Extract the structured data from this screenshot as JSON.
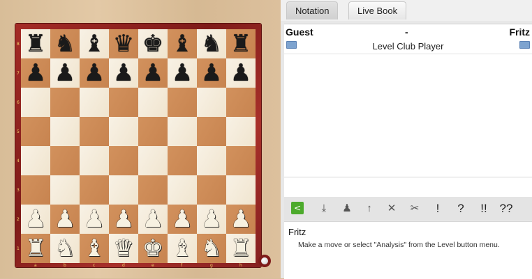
{
  "tabs": [
    {
      "label": "Notation",
      "active": true
    },
    {
      "label": "Live Book",
      "active": false
    }
  ],
  "game": {
    "white_player": "Guest",
    "result": "-",
    "black_player": "Fritz",
    "level": "Level Club Player"
  },
  "toolbar": {
    "icons": [
      "share-icon",
      "download-icon",
      "promote-variation-icon",
      "move-up-icon",
      "delete-move-icon",
      "cut-icon"
    ],
    "annotations": [
      "!",
      "?",
      "!!",
      "??"
    ]
  },
  "engine": {
    "name": "Fritz",
    "message": "Make a move or select \"Analysis\" from the Level button menu."
  },
  "board": {
    "orientation": "white-bottom",
    "files": [
      "a",
      "b",
      "c",
      "d",
      "e",
      "f",
      "g",
      "h"
    ],
    "ranks": [
      "8",
      "7",
      "6",
      "5",
      "4",
      "3",
      "2",
      "1"
    ],
    "position": [
      [
        "r",
        "n",
        "b",
        "q",
        "k",
        "b",
        "n",
        "r"
      ],
      [
        "p",
        "p",
        "p",
        "p",
        "p",
        "p",
        "p",
        "p"
      ],
      [
        "",
        "",
        "",
        "",
        "",
        "",
        "",
        ""
      ],
      [
        "",
        "",
        "",
        "",
        "",
        "",
        "",
        ""
      ],
      [
        "",
        "",
        "",
        "",
        "",
        "",
        "",
        ""
      ],
      [
        "",
        "",
        "",
        "",
        "",
        "",
        "",
        ""
      ],
      [
        "P",
        "P",
        "P",
        "P",
        "P",
        "P",
        "P",
        "P"
      ],
      [
        "R",
        "N",
        "B",
        "Q",
        "K",
        "B",
        "N",
        "R"
      ]
    ],
    "colors": {
      "light": "#f4ead7",
      "dark": "#cc8a55",
      "frame": "#9b2723"
    }
  }
}
